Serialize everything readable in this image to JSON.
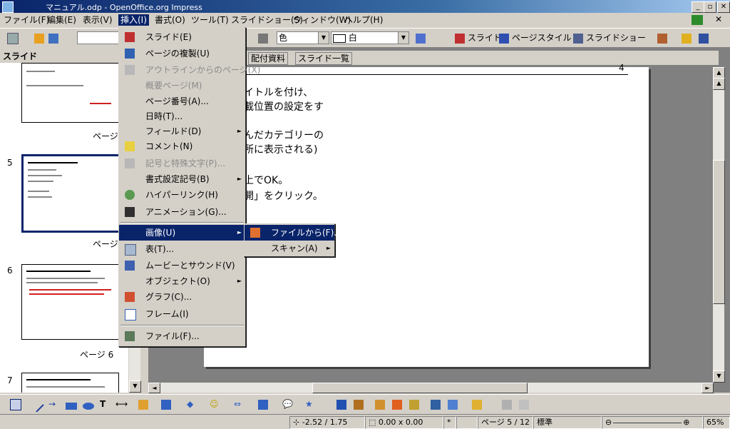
{
  "window": {
    "title": "マニュアル.odp - OpenOffice.org Impress"
  },
  "menubar": [
    "ファイル(F)",
    "編集(E)",
    "表示(V)",
    "挿入(I)",
    "書式(O)",
    "ツール(T)",
    "スライドショー(S)",
    "ウィンドウ(W)",
    "ヘルプ(H)"
  ],
  "toolbar": {
    "color_label": "色",
    "fill_value": "白",
    "slide_label": "スライド",
    "page_style_label": "ページスタイル",
    "slideshow_label": "スライドショー"
  },
  "slide_panel": {
    "title": "スライド",
    "thumbs": [
      {
        "num": "",
        "caption": "ページ"
      },
      {
        "num": "5",
        "caption": "ページ"
      },
      {
        "num": "6",
        "caption": "ページ 6"
      },
      {
        "num": "7",
        "caption": ""
      }
    ]
  },
  "view_tabs": [
    "配付資料",
    "スライド一覧"
  ],
  "slide_text": {
    "header_fragment": "...",
    "page_number": "4",
    "lines": [
      "イトルを付け、",
      "載位置の設定をす",
      "んだカテゴリーの",
      "所に表示される)",
      "上でOK。",
      "開」をクリック。"
    ]
  },
  "insert_menu": {
    "items": [
      {
        "label": "スライド(E)",
        "icon": "slide-icon",
        "disabled": false
      },
      {
        "label": "ページの複製(U)",
        "icon": "duplicate-icon",
        "disabled": false
      },
      {
        "label": "アウトラインからのページ(X)",
        "icon": "outline-icon",
        "disabled": true
      },
      {
        "label": "概要ページ(M)",
        "icon": "",
        "disabled": true
      },
      {
        "label": "ページ番号(A)...",
        "icon": "",
        "disabled": false
      },
      {
        "label": "日時(T)...",
        "icon": "",
        "disabled": false
      },
      {
        "label": "フィールド(D)",
        "icon": "",
        "disabled": false,
        "submenu": true
      },
      {
        "label": "コメント(N)",
        "icon": "comment-icon",
        "disabled": false
      },
      {
        "label": "記号と特殊文字(P)...",
        "icon": "symbol-icon",
        "disabled": true
      },
      {
        "label": "書式設定記号(B)",
        "icon": "",
        "disabled": false,
        "submenu": true
      },
      {
        "label": "ハイパーリンク(H)",
        "icon": "hyperlink-icon",
        "disabled": false
      },
      {
        "label": "アニメーション(G)...",
        "icon": "animation-icon",
        "disabled": false
      },
      {
        "label": "画像(U)",
        "icon": "",
        "disabled": false,
        "submenu": true,
        "highlighted": true
      },
      {
        "label": "表(T)...",
        "icon": "table-icon",
        "disabled": false
      },
      {
        "label": "ムービーとサウンド(V)",
        "icon": "movie-icon",
        "disabled": false
      },
      {
        "label": "オブジェクト(O)",
        "icon": "",
        "disabled": false,
        "submenu": true
      },
      {
        "label": "グラフ(C)...",
        "icon": "chart-icon",
        "disabled": false
      },
      {
        "label": "フレーム(I)",
        "icon": "frame-icon",
        "disabled": false
      },
      {
        "label": "ファイル(F)...",
        "icon": "file-icon",
        "disabled": false
      }
    ]
  },
  "image_submenu": {
    "items": [
      {
        "label": "ファイルから(F)...",
        "highlighted": true
      },
      {
        "label": "スキャン(A)",
        "submenu": true
      }
    ]
  },
  "statusbar": {
    "position": "-2.52 / 1.75",
    "size": "0.00 x 0.00",
    "modified": "*",
    "page": "ページ 5 / 12",
    "layout": "標準",
    "zoom": "65%"
  }
}
